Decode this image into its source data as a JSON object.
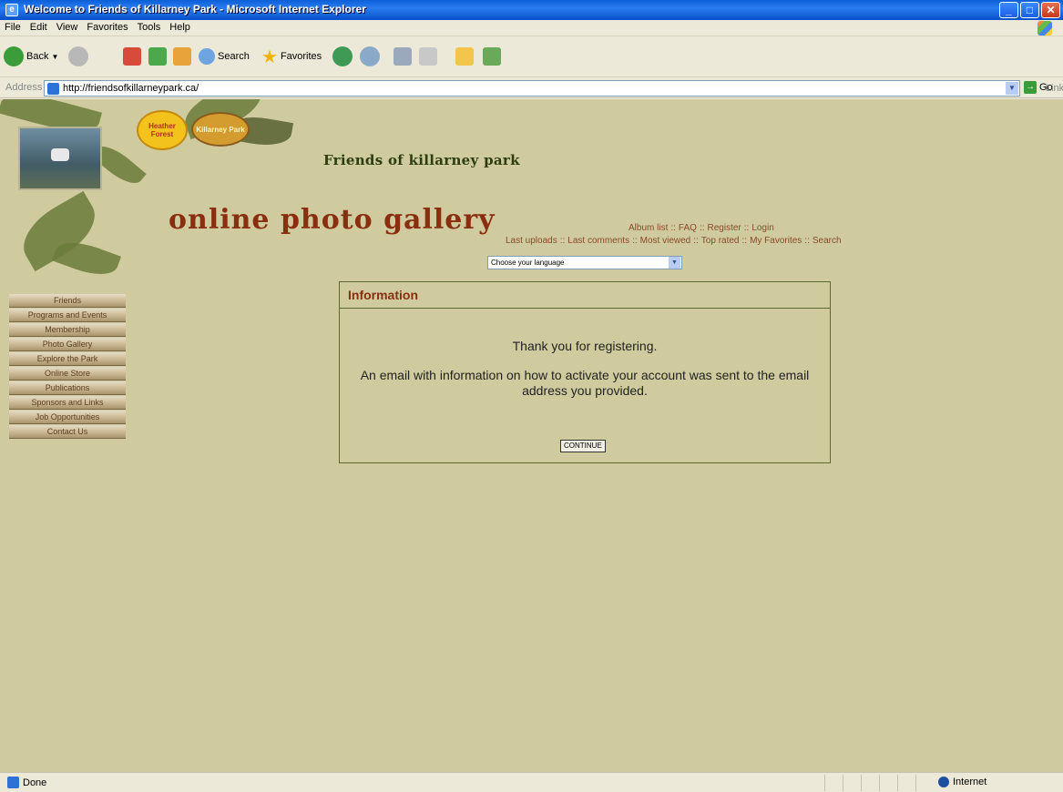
{
  "window": {
    "title": "Welcome to Friends of Killarney Park - Microsoft Internet Explorer",
    "buttons": {
      "minimize": "_",
      "maximize": "□",
      "close": "✕"
    }
  },
  "menu": [
    "File",
    "Edit",
    "View",
    "Favorites",
    "Tools",
    "Help"
  ],
  "toolbar": {
    "back": "Back",
    "search": "Search",
    "favorites": "Favorites"
  },
  "address": {
    "label": "Address",
    "url": "http://friendsofkillarneypark.ca/",
    "go": "Go",
    "links": "Links"
  },
  "page": {
    "site_title": "Friends of killarney park",
    "gallery_title": "online photo gallery",
    "badges": {
      "sun": "Heather Forest",
      "park": "Killarney Park"
    },
    "topnav1": [
      "Album list",
      "FAQ",
      "Register",
      "Login"
    ],
    "topnav2": [
      "Last uploads",
      "Last comments",
      "Most viewed",
      "Top rated",
      "My Favorites",
      "Search"
    ],
    "language_select": "Choose your language",
    "sidenav": [
      "Friends",
      "Programs and Events",
      "Membership",
      "Photo Gallery",
      "Explore the Park",
      "Online Store",
      "Publications",
      "Sponsors and Links",
      "Job Opportunities",
      "Contact Us"
    ],
    "info": {
      "title": "Information",
      "message1": "Thank you for registering.",
      "message2": "An email with information on how to activate your account was sent to the email address you provided.",
      "continue": "CONTINUE"
    }
  },
  "status": {
    "left": "Done",
    "zone": "Internet"
  },
  "colors": {
    "page_bg": "#cfcb9e",
    "title_red": "#8a2e10",
    "link": "#8a4a2a"
  }
}
